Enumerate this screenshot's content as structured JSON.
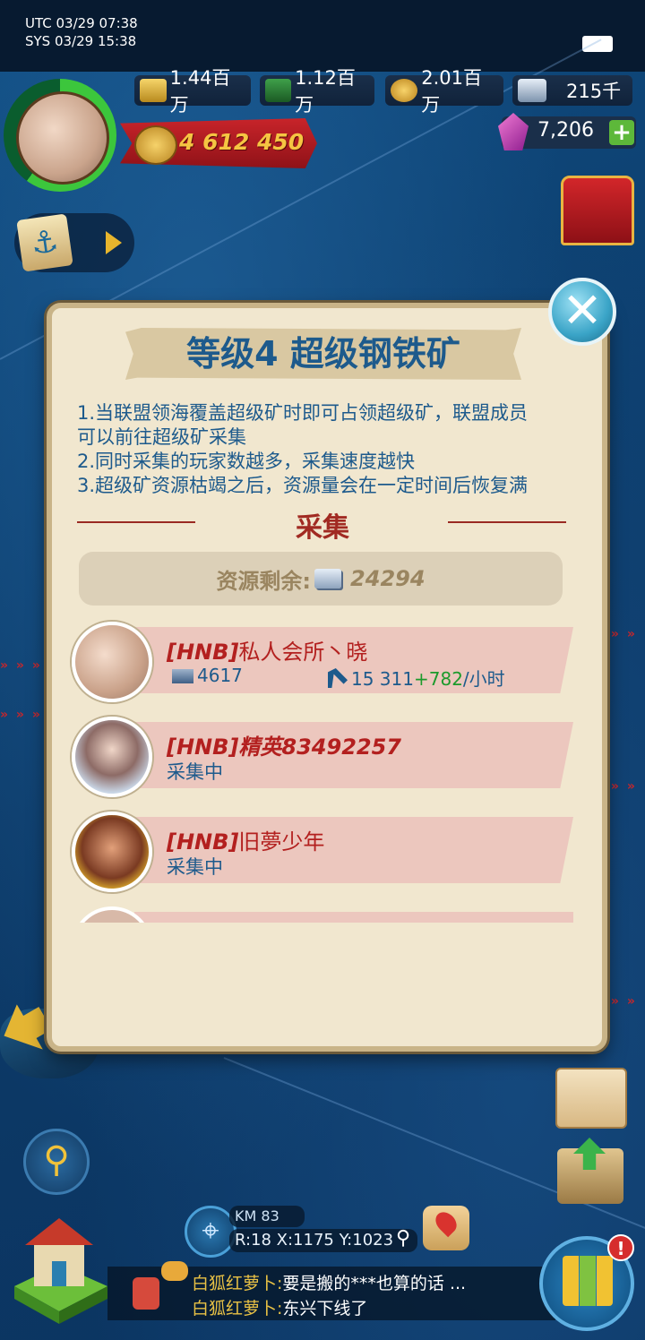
{
  "status_bar": {
    "utc": "UTC 03/29 07:38",
    "sys": "SYS 03/29 15:38"
  },
  "resources": [
    {
      "icon": "gold-bars-icon",
      "value": "1.44百万"
    },
    {
      "icon": "oil-barrel-icon",
      "value": "1.12百万"
    },
    {
      "icon": "coin-icon",
      "value": "2.01百万"
    },
    {
      "icon": "steel-icon",
      "value": "215千"
    }
  ],
  "power": "4 612 450",
  "gems": "7,206",
  "gems_plus": "+",
  "dialog": {
    "title": "等级4 超级钢铁矿",
    "description": [
      "1.当联盟领海覆盖超级矿时即可占领超级矿，联盟成员",
      "可以前往超级矿采集",
      "2.同时采集的玩家数越多，采集速度越快",
      "3.超级矿资源枯竭之后，资源量会在一定时间后恢复满"
    ],
    "section_title": "采集",
    "remaining_label": "资源剩余:",
    "remaining_value": "24294",
    "collectors": [
      {
        "tag": "[HNB]",
        "name": "私人会所丶晓",
        "load": "4617",
        "rate": "15 311",
        "bonus": "+782",
        "unit": "/小时"
      },
      {
        "tag": "[HNB]",
        "name": "精英83492257",
        "status": "采集中"
      },
      {
        "tag": "[HNB]",
        "name": "旧夢少年",
        "status": "采集中"
      }
    ],
    "close": "✕"
  },
  "coords": {
    "km": "KM 83",
    "position": "R:18 X:1175 Y:1023"
  },
  "chat": [
    {
      "who": "白狐红萝卜:",
      "text": "要是搬的***也算的话 ..."
    },
    {
      "who": "白狐红萝卜:",
      "text": "东兴下线了"
    }
  ],
  "grid_badge": "!",
  "colors": {
    "sea": "#0d3a66",
    "dialog_bg": "#f1e7cf",
    "title_blue": "#1d5a8c",
    "name_red": "#b3201f",
    "bonus_green": "#1c9a2c"
  }
}
